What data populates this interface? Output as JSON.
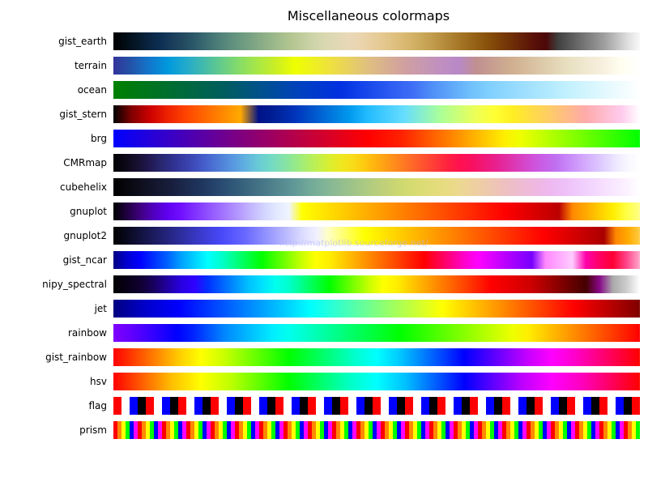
{
  "title": "Miscellaneous colormaps",
  "watermark": "http://matplotlib.sourceforge.net/",
  "colormaps": [
    {
      "id": "gist_earth",
      "label": "gist_earth",
      "class": "cm-gist_earth"
    },
    {
      "id": "terrain",
      "label": "terrain",
      "class": "cm-terrain"
    },
    {
      "id": "ocean",
      "label": "ocean",
      "class": "cm-ocean"
    },
    {
      "id": "gist_stern",
      "label": "gist_stern",
      "class": "cm-gist_stern"
    },
    {
      "id": "brg",
      "label": "brg",
      "class": "cm-brg"
    },
    {
      "id": "CMRmap",
      "label": "CMRmap",
      "class": "cm-CMRmap"
    },
    {
      "id": "cubehelix",
      "label": "cubehelix",
      "class": "cm-cubehelix"
    },
    {
      "id": "gnuplot",
      "label": "gnuplot",
      "class": "cm-gnuplot"
    },
    {
      "id": "gnuplot2",
      "label": "gnuplot2",
      "class": "cm-gnuplot2"
    },
    {
      "id": "gist_ncar",
      "label": "gist_ncar",
      "class": "cm-gist_ncar"
    },
    {
      "id": "nipy_spectral",
      "label": "nipy_spectral",
      "class": "cm-nipy_spectral"
    },
    {
      "id": "jet",
      "label": "jet",
      "class": "cm-jet"
    },
    {
      "id": "rainbow",
      "label": "rainbow",
      "class": "cm-rainbow"
    },
    {
      "id": "gist_rainbow",
      "label": "gist_rainbow",
      "class": "cm-gist_rainbow"
    },
    {
      "id": "hsv",
      "label": "hsv",
      "class": "cm-hsv"
    },
    {
      "id": "flag",
      "label": "flag",
      "class": "cm-flag"
    },
    {
      "id": "prism",
      "label": "prism",
      "class": "cm-prism"
    }
  ]
}
